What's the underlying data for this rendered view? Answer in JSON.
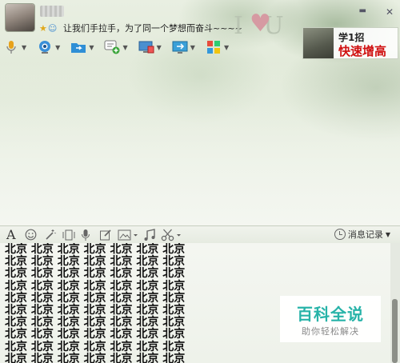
{
  "header": {
    "signature": "让我们手拉手，为了同一个梦想而奋斗~~~~",
    "status_icons": [
      "star-icon",
      "q-icon"
    ],
    "window_buttons": [
      "minimize",
      "close"
    ],
    "deco_letters": "I U"
  },
  "ad": {
    "line1": "学1招",
    "line2": "快速增高"
  },
  "toolbar": {
    "items": [
      {
        "icon": "microphone-icon",
        "has_dropdown": true
      },
      {
        "icon": "webcam-icon",
        "has_dropdown": true
      },
      {
        "icon": "file-transfer-icon",
        "has_dropdown": true
      },
      {
        "icon": "chat-add-icon",
        "has_dropdown": true
      },
      {
        "icon": "remote-desktop-icon",
        "has_dropdown": true
      },
      {
        "icon": "screen-share-icon",
        "has_dropdown": true
      },
      {
        "icon": "apps-icon",
        "has_dropdown": true
      }
    ]
  },
  "input_toolbar": {
    "font_label": "A",
    "history_label": "消息记录"
  },
  "input": {
    "text": "北京 北京 北京 北京 北京 北京 北京\n北京 北京 北京 北京 北京 北京 北京\n北京 北京 北京 北京 北京 北京 北京\n北京 北京 北京 北京 北京 北京 北京\n北京 北京 北京 北京 北京 北京 北京\n北京 北京 北京 北京 北京 北京 北京\n北京 北京 北京 北京 北京 北京 北京\n北京 北京 北京 北京 北京 北京 北京\n北京 北京 北京 北京 北京 北京 北京\n北京 北京 北京 北京 北京 北京 北京"
  },
  "watermark": {
    "title": "百科全说",
    "subtitle": "助你轻松解决"
  },
  "colors": {
    "ad_accent": "#d01010",
    "watermark_accent": "#27b3a8"
  }
}
